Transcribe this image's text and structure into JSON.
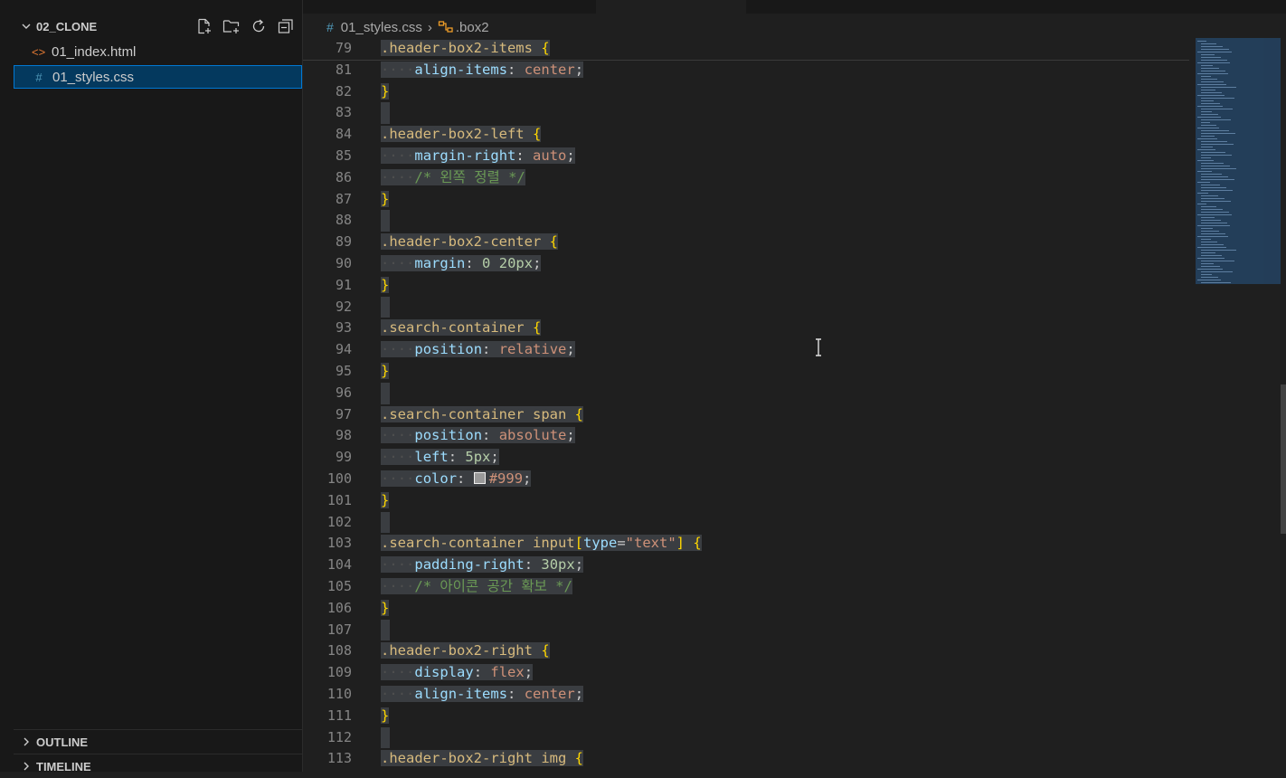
{
  "explorer": {
    "folder_name": "02_CLONE",
    "actions": [
      "new-file-icon",
      "new-folder-icon",
      "refresh-icon",
      "collapse-all-icon"
    ],
    "files": [
      {
        "name": "01_index.html",
        "icon": "html-file-icon",
        "icon_glyph": "<>",
        "icon_color": "#e37933",
        "selected": false
      },
      {
        "name": "01_styles.css",
        "icon": "css-file-icon",
        "icon_glyph": "#",
        "icon_color": "#519aba",
        "selected": true
      }
    ],
    "outline_label": "OUTLINE",
    "timeline_label": "TIMELINE"
  },
  "breadcrumb": {
    "file": "01_styles.css",
    "file_icon": "#",
    "symbol": ".box2"
  },
  "editor": {
    "sticky_line": {
      "number": "79",
      "code": ".header-box2-items {"
    },
    "lines": [
      {
        "number": "81",
        "code": "    align-items: center;"
      },
      {
        "number": "82",
        "code": "}"
      },
      {
        "number": "83",
        "code": ""
      },
      {
        "number": "84",
        "code": ".header-box2-left {"
      },
      {
        "number": "85",
        "code": "    margin-right: auto;"
      },
      {
        "number": "86",
        "code": "    /* 왼쪽 정렬 */"
      },
      {
        "number": "87",
        "code": "}"
      },
      {
        "number": "88",
        "code": ""
      },
      {
        "number": "89",
        "code": ".header-box2-center {"
      },
      {
        "number": "90",
        "code": "    margin: 0 20px;"
      },
      {
        "number": "91",
        "code": "}"
      },
      {
        "number": "92",
        "code": ""
      },
      {
        "number": "93",
        "code": ".search-container {"
      },
      {
        "number": "94",
        "code": "    position: relative;"
      },
      {
        "number": "95",
        "code": "}"
      },
      {
        "number": "96",
        "code": ""
      },
      {
        "number": "97",
        "code": ".search-container span {"
      },
      {
        "number": "98",
        "code": "    position: absolute;"
      },
      {
        "number": "99",
        "code": "    left: 5px;"
      },
      {
        "number": "100",
        "code": "    color: #999;"
      },
      {
        "number": "101",
        "code": "}"
      },
      {
        "number": "102",
        "code": ""
      },
      {
        "number": "103",
        "code": ".search-container input[type=\"text\"] {"
      },
      {
        "number": "104",
        "code": "    padding-right: 30px;"
      },
      {
        "number": "105",
        "code": "    /* 아이콘 공간 확보 */"
      },
      {
        "number": "106",
        "code": "}"
      },
      {
        "number": "107",
        "code": ""
      },
      {
        "number": "108",
        "code": ".header-box2-right {"
      },
      {
        "number": "109",
        "code": "    display: flex;"
      },
      {
        "number": "110",
        "code": "    align-items: center;"
      },
      {
        "number": "111",
        "code": "}"
      },
      {
        "number": "112",
        "code": ""
      },
      {
        "number": "113",
        "code": ".header-box2-right img {"
      }
    ]
  },
  "colors": {
    "selector": "#d7ba7d",
    "brace": "#ffd700",
    "property": "#9cdcfe",
    "value": "#ce9178",
    "number": "#b5cea8",
    "comment": "#6a9955",
    "selection": "#3a3d41",
    "sidebar_selected": "#04395e",
    "accent": "#0078d4"
  }
}
